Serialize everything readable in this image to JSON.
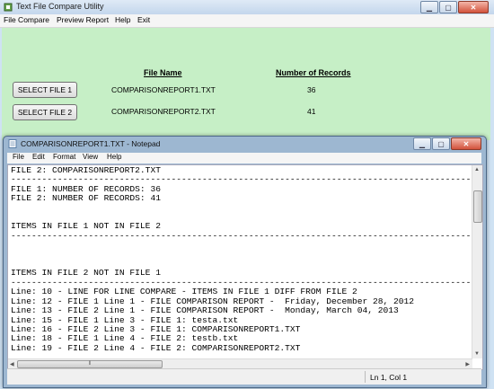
{
  "window": {
    "title": "Text File Compare Utility",
    "menu": [
      "File Compare",
      "Preview Report",
      "Help",
      "Exit"
    ]
  },
  "main": {
    "header_filename": "File Name",
    "header_records": "Number of Records",
    "rows": [
      {
        "button": "SELECT FILE 1",
        "filename": "COMPARISONREPORT1.TXT",
        "records": "36"
      },
      {
        "button": "SELECT FILE 2",
        "filename": "COMPARISONREPORT2.TXT",
        "records": "41"
      }
    ]
  },
  "notepad": {
    "title": "COMPARISONREPORT1.TXT - Notepad",
    "menu": [
      "File",
      "Edit",
      "Format",
      "View",
      "Help"
    ],
    "content": "FILE 2: COMPARISONREPORT2.TXT\n-----------------------------------------------------------------------------------------\nFILE 1: NUMBER OF RECORDS: 36\nFILE 2: NUMBER OF RECORDS: 41\n\n\nITEMS IN FILE 1 NOT IN FILE 2\n-----------------------------------------------------------------------------------------\n\n\n\nITEMS IN FILE 2 NOT IN FILE 1\n-----------------------------------------------------------------------------------------\nLine: 10 - LINE FOR LINE COMPARE - ITEMS IN FILE 1 DIFF FROM FILE 2\nLine: 12 - FILE 1 Line 1 - FILE COMPARISON REPORT -  Friday, December 28, 2012\nLine: 13 - FILE 2 Line 1 - FILE COMPARISON REPORT -  Monday, March 04, 2013\nLine: 15 - FILE 1 Line 3 - FILE 1: testa.txt\nLine: 16 - FILE 2 Line 3 - FILE 1: COMPARISONREPORT1.TXT\nLine: 18 - FILE 1 Line 4 - FILE 2: testb.txt\nLine: 19 - FILE 2 Line 4 - FILE 2: COMPARISONREPORT2.TXT",
    "status_position": "Ln 1, Col 1"
  }
}
